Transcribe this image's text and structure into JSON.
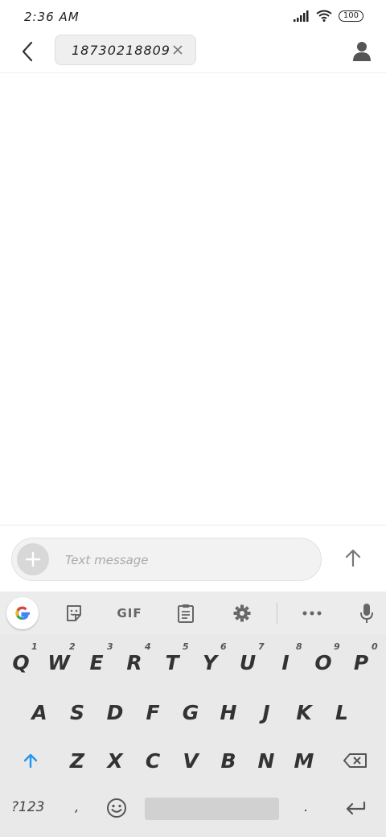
{
  "status_bar": {
    "time": "2:36 AM",
    "battery": "100"
  },
  "header": {
    "recipient_number": "18730218809"
  },
  "compose": {
    "placeholder": "Text message"
  },
  "keyboard": {
    "toolbar": {
      "gif_label": "GIF"
    },
    "row1": [
      {
        "label": "Q",
        "hint": "1"
      },
      {
        "label": "W",
        "hint": "2"
      },
      {
        "label": "E",
        "hint": "3"
      },
      {
        "label": "R",
        "hint": "4"
      },
      {
        "label": "T",
        "hint": "5"
      },
      {
        "label": "Y",
        "hint": "6"
      },
      {
        "label": "U",
        "hint": "7"
      },
      {
        "label": "I",
        "hint": "8"
      },
      {
        "label": "O",
        "hint": "9"
      },
      {
        "label": "P",
        "hint": "0"
      }
    ],
    "row2": [
      "A",
      "S",
      "D",
      "F",
      "G",
      "H",
      "J",
      "K",
      "L"
    ],
    "row3": [
      "Z",
      "X",
      "C",
      "V",
      "B",
      "N",
      "M"
    ],
    "bottom": {
      "symbols_label": "?123",
      "comma": ",",
      "period": "."
    }
  }
}
